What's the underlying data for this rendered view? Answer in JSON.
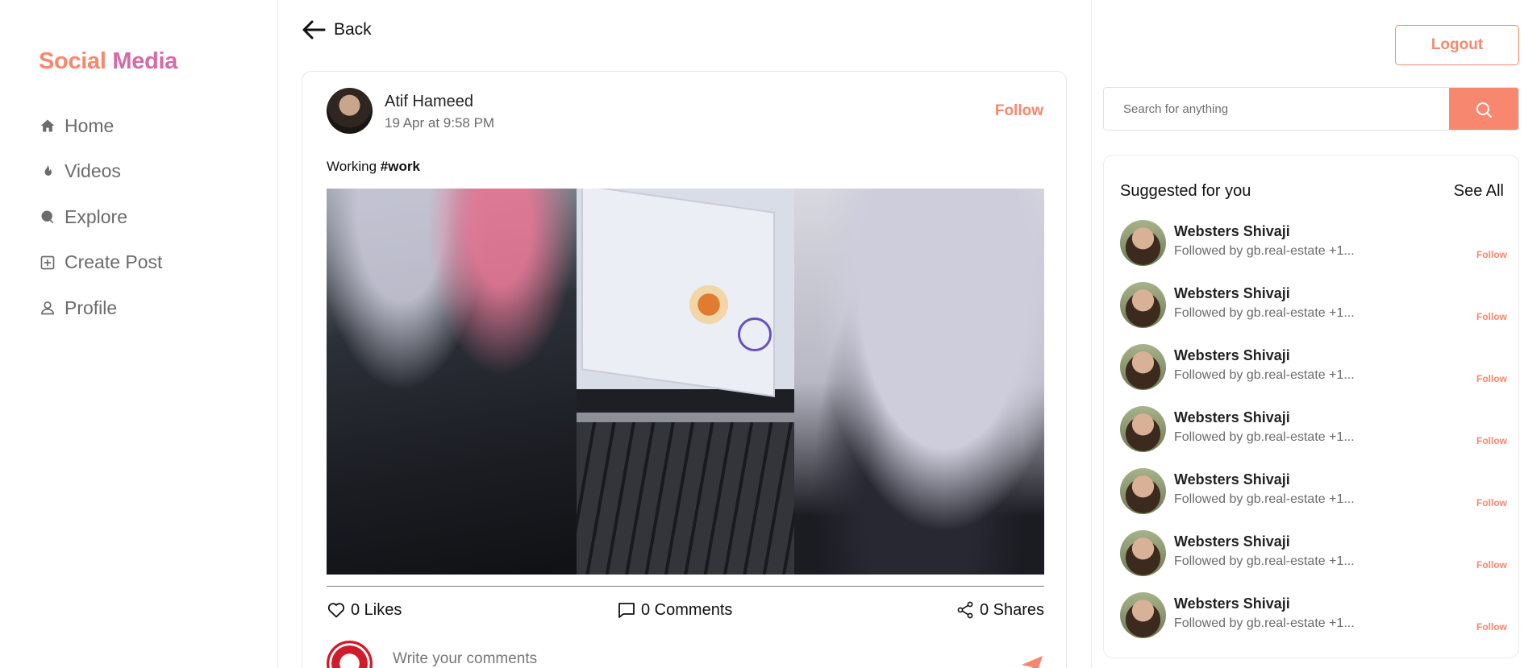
{
  "brand": {
    "part1": "Social",
    "part2": " Media"
  },
  "nav": [
    {
      "label": "Home",
      "icon": "home-icon"
    },
    {
      "label": "Videos",
      "icon": "flame-icon"
    },
    {
      "label": "Explore",
      "icon": "explore-icon"
    },
    {
      "label": "Create Post",
      "icon": "plus-square-icon"
    },
    {
      "label": "Profile",
      "icon": "user-icon"
    }
  ],
  "back_label": "Back",
  "post": {
    "author": "Atif Hameed",
    "date": "19 Apr at 9:58 PM",
    "follow_label": "Follow",
    "caption_text": "Working ",
    "caption_tag": "#work",
    "likes": "0 Likes",
    "comments": "0 Comments",
    "shares": "0 Shares",
    "comment_placeholder": "Write your comments"
  },
  "header": {
    "logout_label": "Logout"
  },
  "search": {
    "placeholder": "Search for anything"
  },
  "suggestions": {
    "title": "Suggested for you",
    "see_all": "See All",
    "items": [
      {
        "name": "Websters Shivaji",
        "sub": "Followed by gb.real-estate +1...",
        "follow": "Follow"
      },
      {
        "name": "Websters Shivaji",
        "sub": "Followed by gb.real-estate +1...",
        "follow": "Follow"
      },
      {
        "name": "Websters Shivaji",
        "sub": "Followed by gb.real-estate +1...",
        "follow": "Follow"
      },
      {
        "name": "Websters Shivaji",
        "sub": "Followed by gb.real-estate +1...",
        "follow": "Follow"
      },
      {
        "name": "Websters Shivaji",
        "sub": "Followed by gb.real-estate +1...",
        "follow": "Follow"
      },
      {
        "name": "Websters Shivaji",
        "sub": "Followed by gb.real-estate +1...",
        "follow": "Follow"
      },
      {
        "name": "Websters Shivaji",
        "sub": "Followed by gb.real-estate +1...",
        "follow": "Follow"
      }
    ]
  },
  "colors": {
    "accent": "#f7886f",
    "brand_pink": "#d46aa7"
  }
}
